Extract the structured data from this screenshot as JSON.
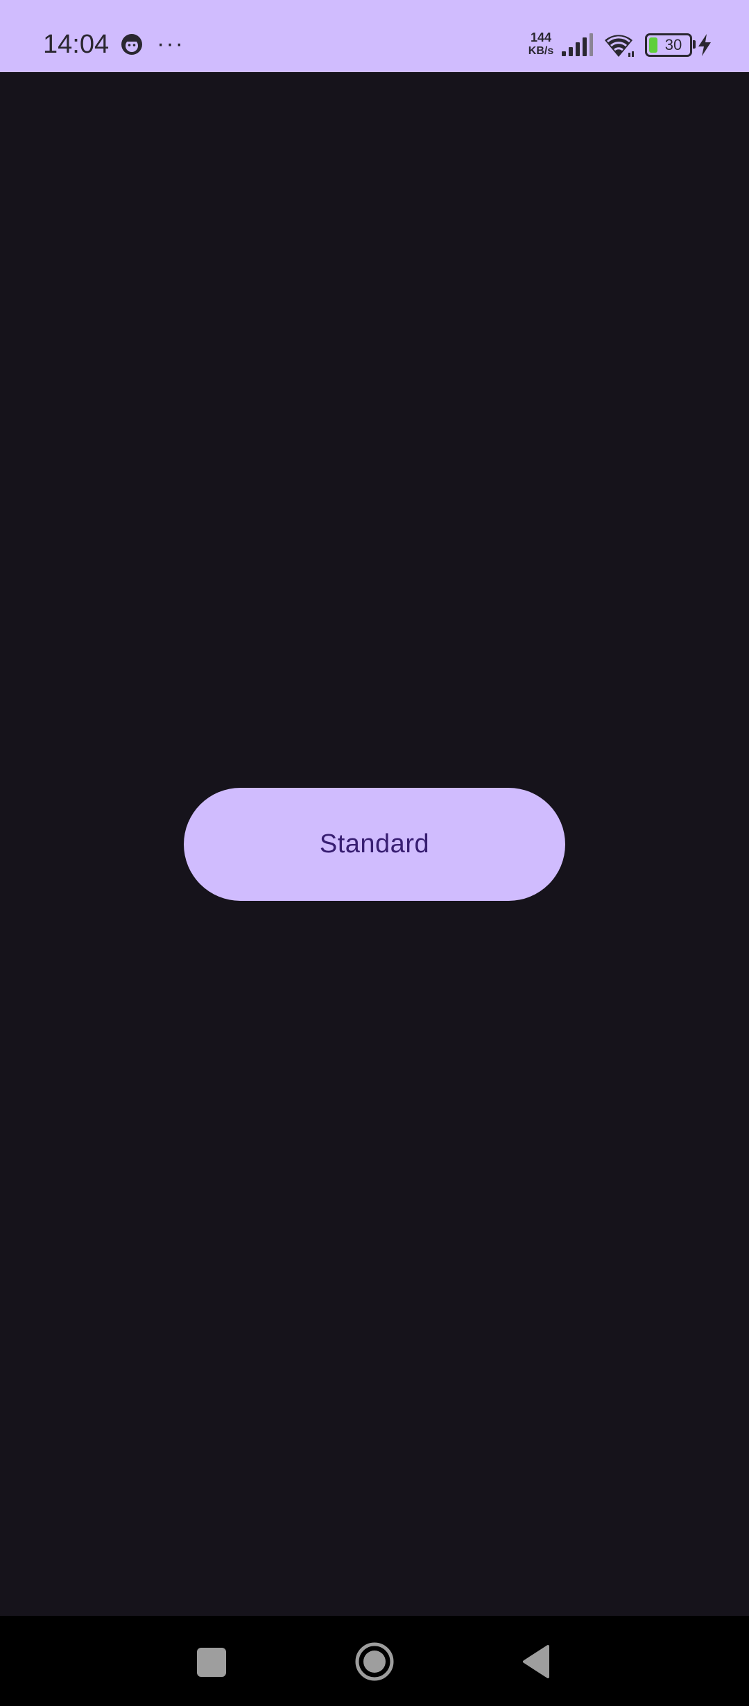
{
  "status_bar": {
    "time": "14:04",
    "more_indicator": "···",
    "net_speed_value": "144",
    "net_speed_unit": "KB/s",
    "battery_level": "30",
    "icons": [
      "notification-face-icon",
      "more-dots-icon",
      "signal-icon",
      "wifi-icon",
      "battery-icon",
      "charging-icon"
    ],
    "background_color": "#d0bcfe"
  },
  "main": {
    "button_label": "Standard",
    "background_color": "#16131b",
    "button_color": "#d0bcfe",
    "button_text_color": "#381e72"
  },
  "nav_bar": {
    "icons": [
      "recents-icon",
      "home-icon",
      "back-icon"
    ]
  }
}
